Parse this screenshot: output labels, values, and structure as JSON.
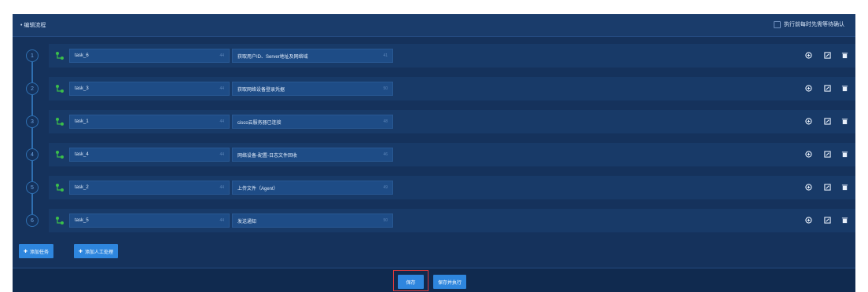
{
  "header": {
    "title": "• 编辑流程",
    "confirm_label": "执行前每时先需等待确认"
  },
  "tasks": [
    {
      "step": "1",
      "name": "task_6",
      "name_count": "44",
      "desc": "获取用户ID、Server地址及网络域",
      "desc_count": "41"
    },
    {
      "step": "2",
      "name": "task_3",
      "name_count": "44",
      "desc": "获取网络设备登录凭据",
      "desc_count": "50"
    },
    {
      "step": "3",
      "name": "task_1",
      "name_count": "44",
      "desc": "cisco云服务器已连接",
      "desc_count": "48"
    },
    {
      "step": "4",
      "name": "task_4",
      "name_count": "44",
      "desc": "网络设备-配置-日志文件回收",
      "desc_count": "46"
    },
    {
      "step": "5",
      "name": "task_2",
      "name_count": "44",
      "desc": "上传文件（Agent）",
      "desc_count": "49"
    },
    {
      "step": "6",
      "name": "task_5",
      "name_count": "44",
      "desc": "发送通知",
      "desc_count": "50"
    }
  ],
  "buttons": {
    "add_task": "添加任务",
    "add_manual": "添加人工处理",
    "save": "保存",
    "save_run": "保存并执行"
  },
  "icons": {
    "task": "task-node-icon",
    "add": "plus-icon",
    "action1": "plus-circle-icon",
    "action2": "edit-icon",
    "action3": "trash-icon"
  },
  "colors": {
    "panel": "#15325c",
    "accent": "#2e86de",
    "task_icon": "#3bbf4a",
    "highlight": "#e03b3b"
  }
}
